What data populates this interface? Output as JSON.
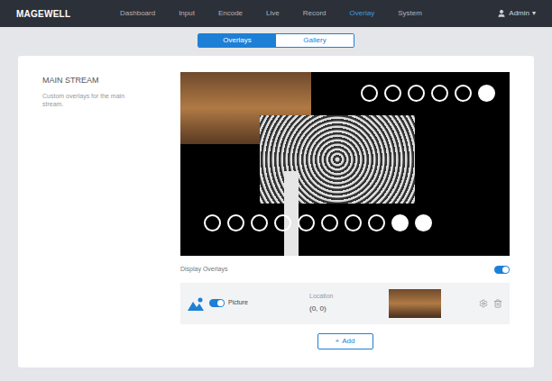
{
  "brand": "MAGEWELL",
  "nav": [
    {
      "label": "Dashboard",
      "selected": false
    },
    {
      "label": "Input",
      "selected": false
    },
    {
      "label": "Encode",
      "selected": false
    },
    {
      "label": "Live",
      "selected": false
    },
    {
      "label": "Record",
      "selected": false
    },
    {
      "label": "Overlay",
      "selected": true
    },
    {
      "label": "System",
      "selected": false
    }
  ],
  "user": {
    "name": "Admin",
    "caret": "▾"
  },
  "tabs": [
    {
      "label": "Overlays",
      "selected": true
    },
    {
      "label": "Gallery",
      "selected": false
    }
  ],
  "section": {
    "title": "MAIN STREAM",
    "description": "Custom overlays for the main stream."
  },
  "display_overlays": {
    "label": "Display Overlays",
    "on": true
  },
  "overlays": [
    {
      "name": "Picture",
      "on": true,
      "location_label": "Location",
      "location": "(0, 0)"
    }
  ],
  "add_button": {
    "icon": "+",
    "label": "Add"
  }
}
